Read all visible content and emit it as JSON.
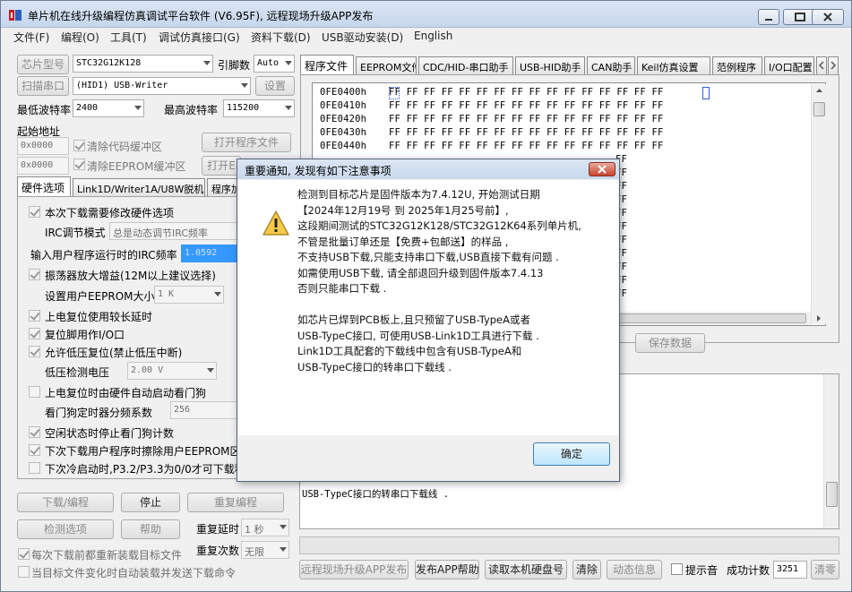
{
  "window": {
    "title": "单片机在线升级编程仿真调试平台软件 (V6.95F), 远程现场升级APP发布"
  },
  "menu": [
    "文件(F)",
    "编程(O)",
    "工具(T)",
    "调试仿真接口(G)",
    "资料下载(D)",
    "USB驱动安装(D)",
    "English"
  ],
  "left": {
    "chip_label": "芯片型号",
    "chip_value": "STC32G12K128",
    "pins_label": "引脚数",
    "pins_value": "Auto",
    "scan_label": "扫描串口",
    "port_value": "(HID1) USB-Writer",
    "settings_label": "设置",
    "min_baud_label": "最低波特率",
    "min_baud_value": "2400",
    "max_baud_label": "最高波特率",
    "max_baud_value": "115200",
    "start_addr_label": "起始地址",
    "addr1": "0x0000",
    "clear_code_label": "清除代码缓冲区",
    "open_prog_label": "打开程序文件",
    "addr2": "0x0000",
    "clear_eeprom_label": "清除EEPROM缓冲区",
    "open_eeprom_label": "打开E",
    "tabs": [
      "硬件选项",
      "Link1D/Writer1A/U8W脱机",
      "程序加"
    ],
    "hw": {
      "modify_hw": "本次下载需要修改硬件选项",
      "irc_mode_label": "IRC调节模式",
      "irc_mode_value": "总是动态调节IRC频率",
      "irc_freq_label": "输入用户程序运行时的IRC频率",
      "irc_freq_value": "1.0592",
      "osc_gain": "振荡器放大增益(12M以上建议选择)",
      "eeprom_size_label": "设置用户EEPROM大小",
      "eeprom_size_value": "1   K",
      "power_delay": "上电复位使用较长延时",
      "reset_io": "复位脚用作I/O口",
      "lvd_reset": "允许低压复位(禁止低压中断)",
      "lvd_label": "低压检测电压",
      "lvd_value": "2.00 V",
      "wdt_auto": "上电复位时由硬件自动启动看门狗",
      "wdt_div_label": "看门狗定时器分频系数",
      "wdt_div_value": "256",
      "idle_wdt": "空闲状态时停止看门狗计数",
      "erase_eeprom": "下次下载用户程序时擦除用户EEPROM区",
      "cold_boot": "下次冷启动时,P3.2/P3.3为0/0才可下载程"
    },
    "download_label": "下载/编程",
    "stop_label": "停止",
    "reprogram_label": "重复编程",
    "check_label": "检测选项",
    "help_label": "帮助",
    "repeat_delay_label": "重复延时",
    "repeat_delay_value": "1 秒",
    "repeat_count_label": "重复次数",
    "repeat_count_value": "无限",
    "reload_label": "每次下载前都重新装载目标文件",
    "auto_send_label": "当目标文件变化时自动装载并发送下载命令"
  },
  "right": {
    "tabs": [
      "程序文件",
      "EEPROM文件",
      "CDC/HID-串口助手",
      "USB-HID助手",
      "CAN助手",
      "Keil仿真设置",
      "范例程序",
      "I/O口配置"
    ],
    "hex_rows": [
      {
        "addr": "0FE0400h",
        "bytes": "FF FF FF FF FF FF FF FF FF FF FF FF FF FF FF FF"
      },
      {
        "addr": "0FE0410h",
        "bytes": "FF FF FF FF FF FF FF FF FF FF FF FF FF FF FF FF"
      },
      {
        "addr": "0FE0420h",
        "bytes": "FF FF FF FF FF FF FF FF FF FF FF FF FF FF FF FF"
      },
      {
        "addr": "0FE0430h",
        "bytes": "FF FF FF FF FF FF FF FF FF FF FF FF FF FF FF FF"
      },
      {
        "addr": "0FE0440h",
        "bytes": "FF FF FF FF FF FF FF FF FF FF FF FF FF FF FF FF"
      }
    ],
    "hex_partial_rows": [
      "FF",
      "FF",
      "FF",
      "FF",
      "FF",
      "FF",
      "FF",
      "FF",
      "FF",
      "FF",
      "FF"
    ],
    "save_data_label": "保存数据",
    "log_lines": [
      "USB-TypeC接口的转串口下载线 ."
    ],
    "remote_upgrade_label": "远程现场升级APP发布",
    "publish_help_label": "发布APP帮助",
    "read_disk_label": "读取本机硬盘号",
    "clear_label": "清除",
    "anim_label": "动态信息",
    "beep_label": "提示音",
    "success_label": "成功计数",
    "success_value": "3251",
    "clear_count_label": "清零"
  },
  "dialog": {
    "title": "重要通知, 发现有如下注意事项",
    "lines": [
      "检测到目标芯片是固件版本为7.4.12U, 开始测试日期",
      "【2024年12月19号 到 2025年1月25号前】,",
      "这段期间测试的STC32G12K128/STC32G12K64系列单片机,",
      "不管是批量订单还是【免费+包邮送】的样品 ,",
      "不支持USB下载,只能支持串口下载,USB直接下载有问题 .",
      "如需使用USB下载, 请全部退回升级到固件版本7.4.13",
      "否则只能串口下载 .",
      "",
      "如芯片已焊到PCB板上,且只预留了USB-TypeA或者",
      "USB-TypeC接口, 可使用USB-Link1D工具进行下载 .",
      "Link1D工具配套的下载线中包含有USB-TypeA和",
      "USB-TypeC接口的转串口下载线 ."
    ],
    "ok_label": "确定"
  },
  "colors": {
    "accent": "#3399ff",
    "dialog_bg": "#ffffff",
    "title_bg": "#c9d8ec"
  }
}
